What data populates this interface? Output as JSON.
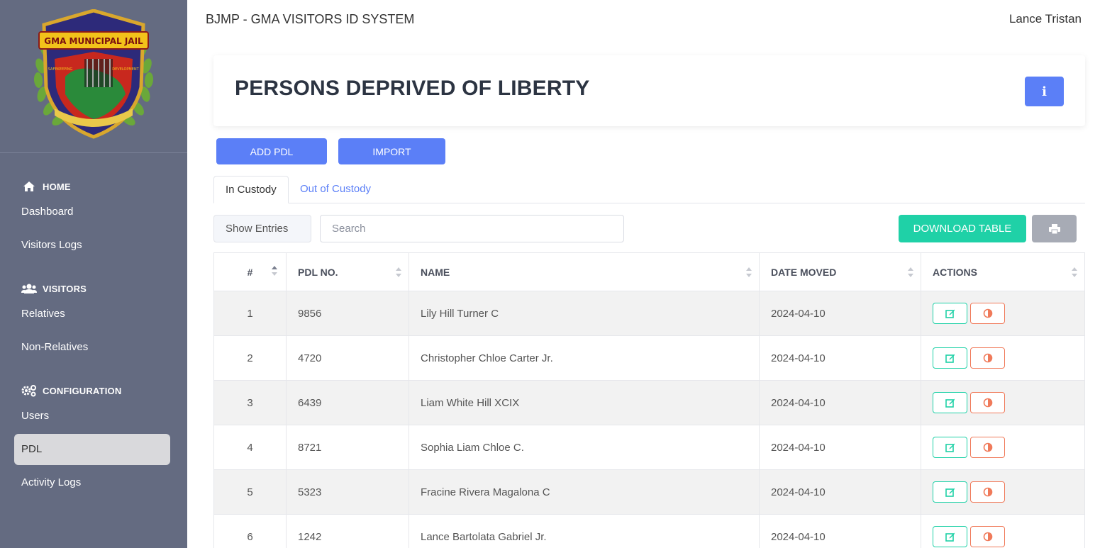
{
  "app": {
    "title": "BJMP - GMA VISITORS ID SYSTEM",
    "user": "Lance Tristan"
  },
  "logo": {
    "text": "GMA MUNICIPAL JAIL",
    "left_word": "SAFEKEEPING",
    "right_word": "DEVELOPMENT"
  },
  "sidebar": {
    "sections": [
      {
        "label": "HOME",
        "icon": "home-icon"
      },
      {
        "label": "VISITORS",
        "icon": "users-icon"
      },
      {
        "label": "CONFIGURATION",
        "icon": "cogs-icon"
      }
    ],
    "items": [
      {
        "label": "Dashboard"
      },
      {
        "label": "Visitors Logs"
      },
      {
        "label": "Relatives"
      },
      {
        "label": "Non-Relatives"
      },
      {
        "label": "Users"
      },
      {
        "label": "PDL",
        "active": true
      },
      {
        "label": "Activity Logs"
      }
    ]
  },
  "page": {
    "title": "PERSONS DEPRIVED OF LIBERTY",
    "info_icon": "info-icon"
  },
  "actions": {
    "add": "ADD PDL",
    "import": "IMPORT",
    "download": "DOWNLOAD TABLE",
    "print_icon": "print-icon"
  },
  "tabs": [
    {
      "label": "In Custody",
      "active": true
    },
    {
      "label": "Out of Custody"
    }
  ],
  "controls": {
    "show_entries": "Show Entries",
    "search_placeholder": "Search"
  },
  "table": {
    "headers": [
      "#",
      "PDL NO.",
      "NAME",
      "DATE MOVED",
      "ACTIONS"
    ],
    "rows": [
      {
        "num": "1",
        "pdl_no": "9856",
        "name": "Lily Hill Turner C",
        "date": "2024-04-10"
      },
      {
        "num": "2",
        "pdl_no": "4720",
        "name": "Christopher Chloe Carter Jr.",
        "date": "2024-04-10"
      },
      {
        "num": "3",
        "pdl_no": "6439",
        "name": "Liam White Hill XCIX",
        "date": "2024-04-10"
      },
      {
        "num": "4",
        "pdl_no": "8721",
        "name": "Sophia Liam Chloe C.",
        "date": "2024-04-10"
      },
      {
        "num": "5",
        "pdl_no": "5323",
        "name": "Fracine Rivera Magalona C",
        "date": "2024-04-10"
      },
      {
        "num": "6",
        "pdl_no": "1242",
        "name": "Lance Bartolata Gabriel Jr.",
        "date": "2024-04-10"
      }
    ]
  },
  "colors": {
    "sidebar": "#646b81",
    "primary": "#5b7ff7",
    "success": "#1fd1a7",
    "danger": "#f07a5a",
    "muted": "#a7abb5"
  }
}
